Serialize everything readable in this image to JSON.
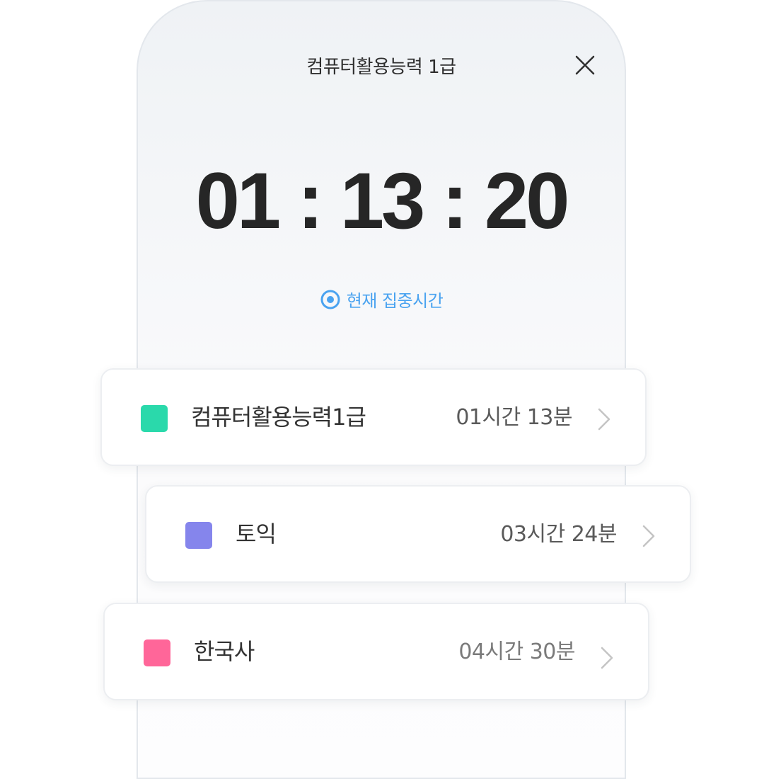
{
  "timer_screen": {
    "title": "컴퓨터활용능력 1급",
    "close_icon": "close-icon",
    "elapsed": "01 : 13 : 20",
    "focus_label": "현재 집중시간",
    "focus_icon": "target-dot-icon",
    "accent_color": "#4aa3f0"
  },
  "subjects": [
    {
      "name": "컴퓨터활용능력1급",
      "time": "01시간 13분",
      "color": "#2ad9ab",
      "chevron": "chevron-right-icon"
    },
    {
      "name": "토익",
      "time": "03시간 24분",
      "color": "#8585ec",
      "chevron": "chevron-right-icon"
    },
    {
      "name": "한국사",
      "time": "04시간 30분",
      "color": "#ff6699",
      "chevron": "chevron-right-icon"
    }
  ]
}
